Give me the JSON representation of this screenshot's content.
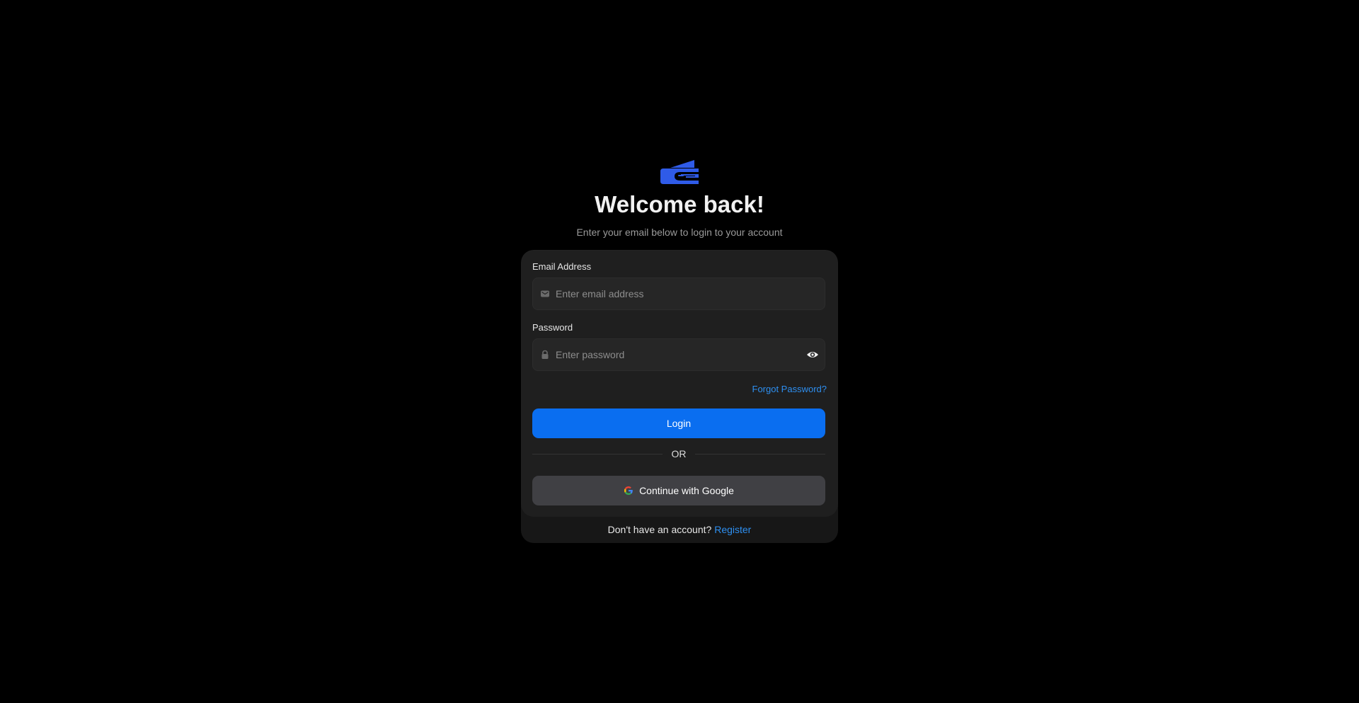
{
  "header": {
    "logo_icon": "wallet-card-logo",
    "title": "Welcome back!",
    "subtitle": "Enter your email below to login to your account"
  },
  "form": {
    "email": {
      "label": "Email Address",
      "placeholder": "Enter email address",
      "value": "",
      "icon": "mail-icon"
    },
    "password": {
      "label": "Password",
      "placeholder": "Enter password",
      "value": "",
      "icon": "lock-icon",
      "toggle_icon": "eye-icon"
    },
    "forgot_label": "Forgot Password?",
    "login_label": "Login",
    "divider_label": "OR",
    "google_label": "Continue with Google",
    "google_icon": "google-icon"
  },
  "footer": {
    "prompt": "Don't have an account?",
    "register_label": "Register"
  },
  "colors": {
    "background": "#000000",
    "card": "#1f1f1f",
    "accent": "#0a6ef0",
    "link": "#2e8ff0",
    "logo": "#2f5be8",
    "google_button": "#404044"
  }
}
